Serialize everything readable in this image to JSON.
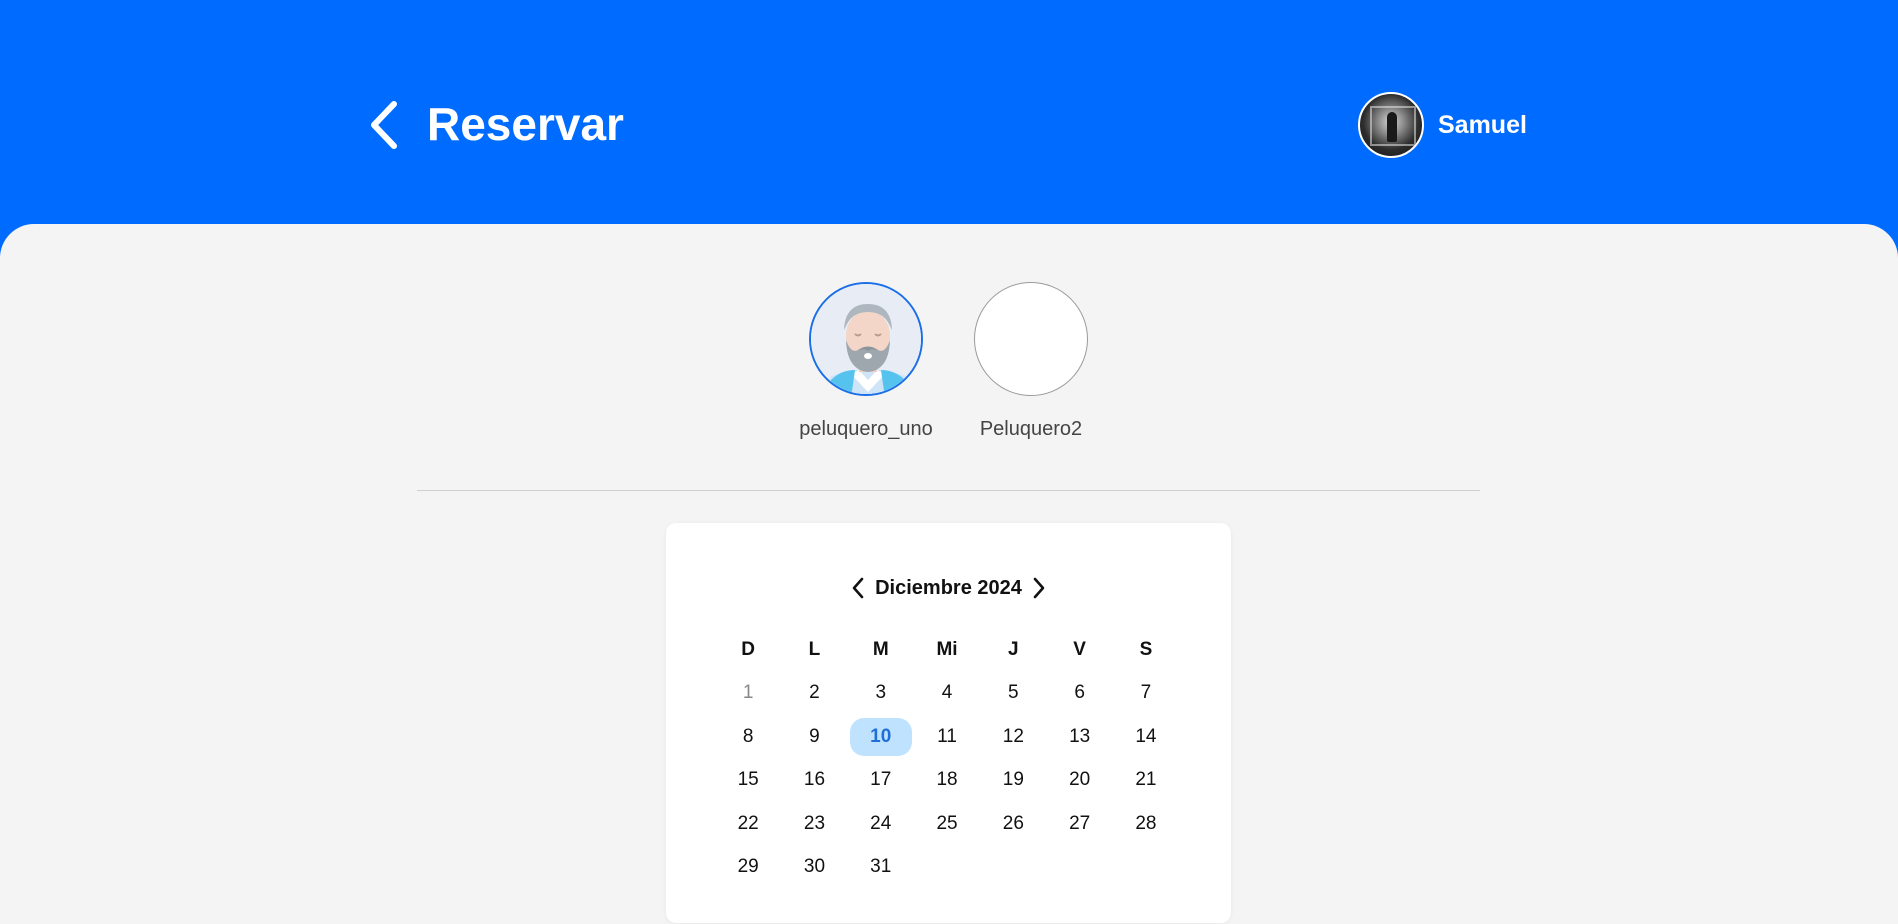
{
  "header": {
    "title": "Reservar",
    "user_name": "Samuel",
    "background_color": "#006cff",
    "icons": {
      "back": "chevron-left-icon"
    }
  },
  "barbers": [
    {
      "name": "peluquero_uno",
      "selected": true,
      "has_photo": true
    },
    {
      "name": "Peluquero2",
      "selected": false,
      "has_photo": false
    }
  ],
  "calendar": {
    "month_label": "Diciembre 2024",
    "weekdays": [
      "D",
      "L",
      "M",
      "Mi",
      "J",
      "V",
      "S"
    ],
    "weeks": [
      [
        "1",
        "2",
        "3",
        "4",
        "5",
        "6",
        "7"
      ],
      [
        "8",
        "9",
        "10",
        "11",
        "12",
        "13",
        "14"
      ],
      [
        "15",
        "16",
        "17",
        "18",
        "19",
        "20",
        "21"
      ],
      [
        "22",
        "23",
        "24",
        "25",
        "26",
        "27",
        "28"
      ],
      [
        "29",
        "30",
        "31",
        "",
        "",
        "",
        ""
      ]
    ],
    "selected_day": "10",
    "disabled_days": [
      "1"
    ],
    "accent_color": "#1f6fd6",
    "selected_bg_color": "#bfe3ff"
  }
}
